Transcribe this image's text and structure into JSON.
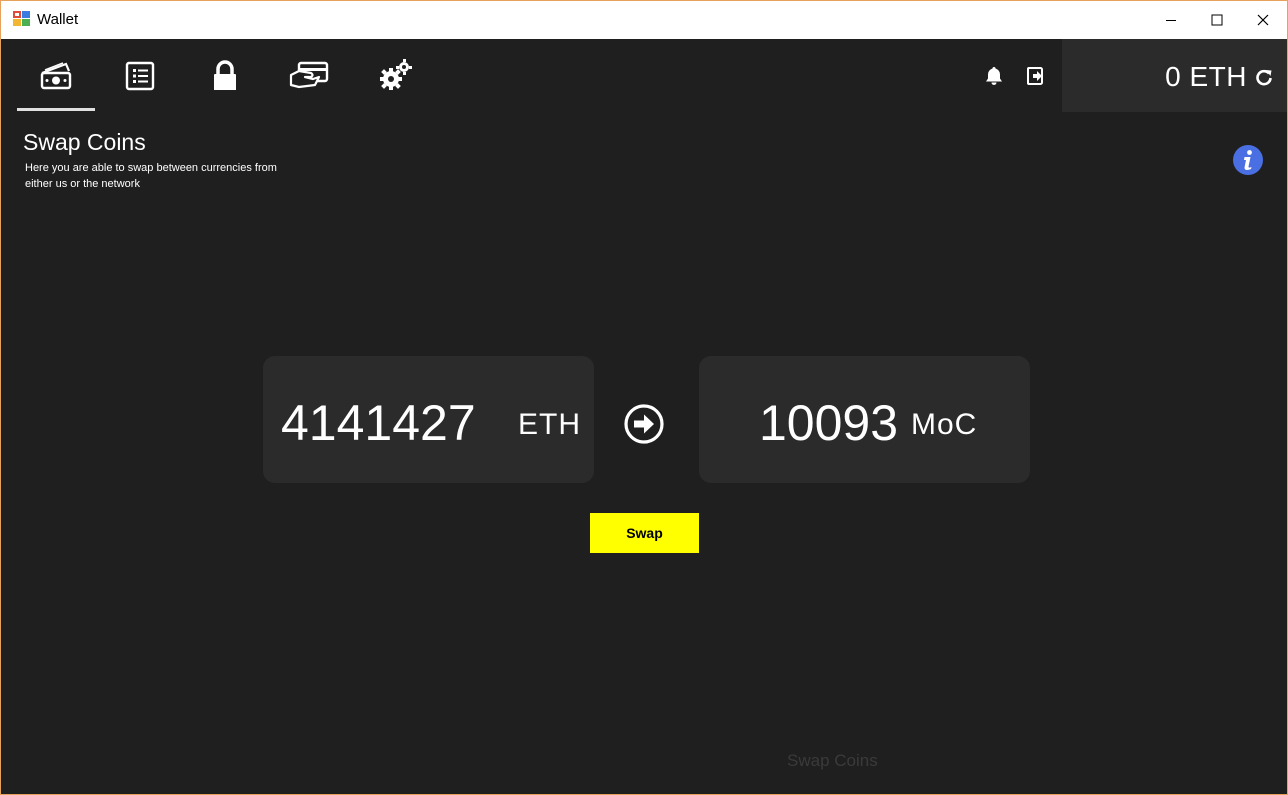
{
  "window": {
    "title": "Wallet"
  },
  "nav": {
    "items": [
      {
        "icon": "money-wallet-icon",
        "active": true
      },
      {
        "icon": "list-icon",
        "active": false
      },
      {
        "icon": "lock-icon",
        "active": false
      },
      {
        "icon": "card-hand-icon",
        "active": false
      },
      {
        "icon": "gears-icon",
        "active": false
      }
    ],
    "notification_icon": "bell-icon",
    "logout_icon": "logout-icon",
    "balance": "0 ETH",
    "refresh_icon": "refresh-icon"
  },
  "header": {
    "title": "Swap Coins",
    "subtitle": "Here you are able to swap between currencies from either us or the network"
  },
  "swap": {
    "from_amount": "4141427",
    "from_currency": "ETH",
    "to_amount": "10093",
    "to_currency": "MoC",
    "button_label": "Swap"
  },
  "footer": {
    "label": "Swap Coins"
  },
  "colors": {
    "background": "#1f1f1f",
    "panel": "#2b2b2b",
    "accent_button": "#ffff00",
    "info": "#4a6fe3",
    "window_border": "#e8a15a"
  }
}
